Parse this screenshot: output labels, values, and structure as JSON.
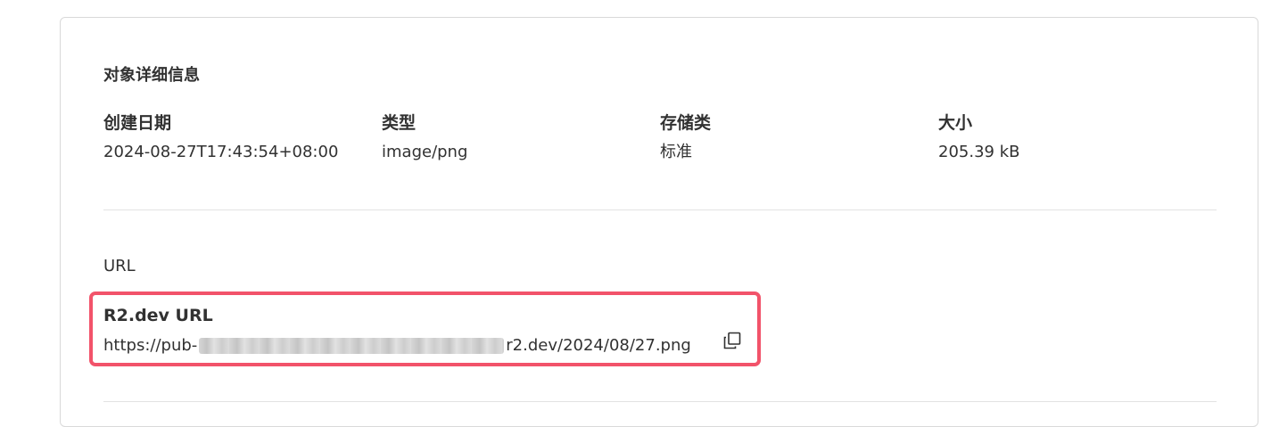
{
  "details": {
    "title": "对象详细信息",
    "fields": [
      {
        "label": "创建日期",
        "value": "2024-08-27T17:43:54+08:00"
      },
      {
        "label": "类型",
        "value": "image/png"
      },
      {
        "label": "存储类",
        "value": "标准"
      },
      {
        "label": "大小",
        "value": "205.39 kB"
      }
    ]
  },
  "url_section": {
    "title": "URL",
    "r2_dev": {
      "label": "R2.dev URL",
      "prefix": "https://pub-",
      "suffix": "r2.dev/2024/08/27.png",
      "copy_icon": "copy-icon"
    }
  },
  "colors": {
    "highlight": "#f2536a",
    "border": "#d9d9d9",
    "text": "#313131"
  }
}
